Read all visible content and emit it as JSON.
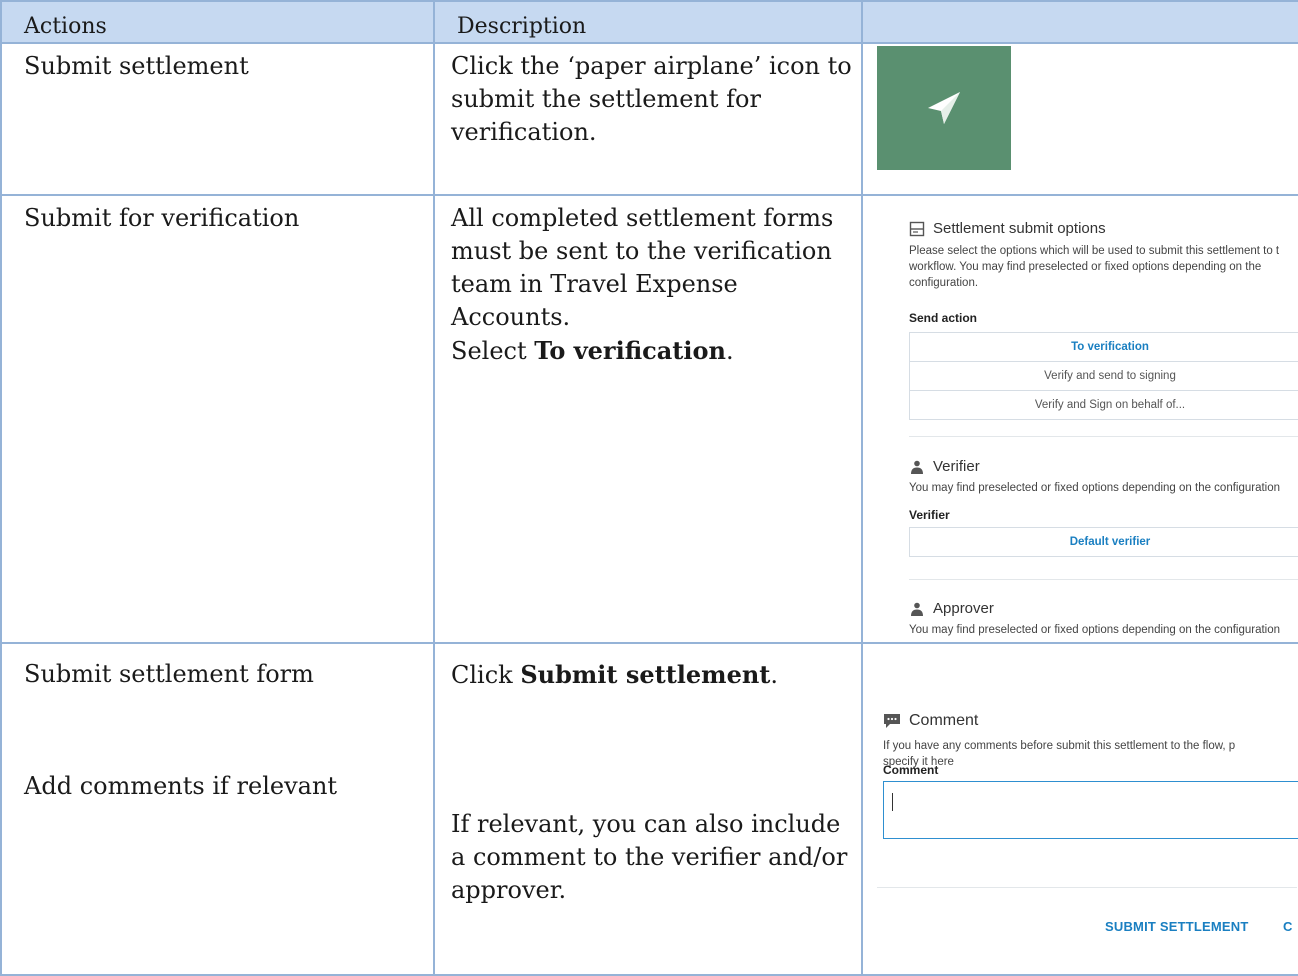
{
  "header": {
    "col_actions": "Actions",
    "col_description": "Description",
    "col_image": ""
  },
  "rows": [
    {
      "action": "Submit settlement",
      "description": "Click the ‘paper airplane’ icon to submit the settlement for verification."
    },
    {
      "action": "Submit for verification",
      "description_pre": "All completed settlement forms must be sent to the verification team in Travel Expense Accounts.",
      "description_select": "Select ",
      "description_bold": "To verification",
      "description_end": "."
    },
    {
      "action": "Submit settlement form",
      "action_2": "Add comments if relevant",
      "desc_click": "Click ",
      "desc_click_bold": "Submit settlement",
      "desc_click_end": ".",
      "description_2": "If relevant, you can also include a comment to the verifier and/or approver."
    }
  ],
  "submit_panel": {
    "title": "Settlement submit options",
    "desc_line1": "Please select the options which will be used to submit this settlement to t",
    "desc_line2": "workflow. You may find preselected or fixed options depending on the",
    "desc_line3": "configuration.",
    "send_action_label": "Send action",
    "options": [
      {
        "label": "To verification",
        "selected": true
      },
      {
        "label": "Verify and send to signing",
        "selected": false
      },
      {
        "label": "Verify and Sign on behalf of...",
        "selected": false
      }
    ],
    "verifier_title": "Verifier",
    "verifier_desc": "You may find preselected or fixed options depending on the configuration",
    "verifier_label": "Verifier",
    "verifier_option": "Default verifier",
    "approver_title": "Approver",
    "approver_desc": "You may find preselected or fixed options depending on the configuration"
  },
  "comment_panel": {
    "title": "Comment",
    "desc_line1": "If you have any comments before submit this settlement to the flow, p",
    "desc_line2": "specify it here",
    "label": "Comment",
    "input_value": "",
    "submit_label": "SUBMIT SETTLEMENT",
    "cut_label": "C"
  },
  "colors": {
    "header_bg": "#c6d9f1",
    "border": "#95b3d7",
    "airplane_bg": "#5a9070",
    "accent": "#1a7fc1"
  }
}
